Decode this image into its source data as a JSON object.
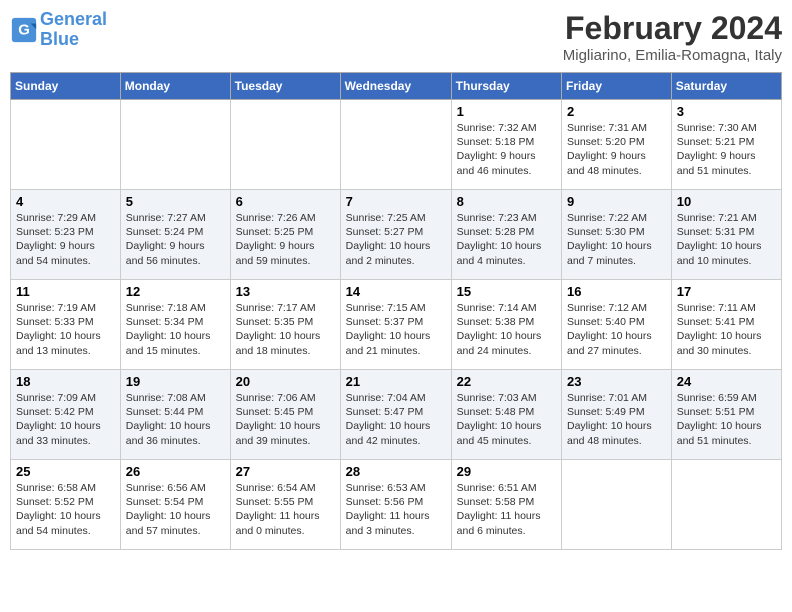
{
  "header": {
    "logo_line1": "General",
    "logo_line2": "Blue",
    "month_title": "February 2024",
    "location": "Migliarino, Emilia-Romagna, Italy"
  },
  "days_of_week": [
    "Sunday",
    "Monday",
    "Tuesday",
    "Wednesday",
    "Thursday",
    "Friday",
    "Saturday"
  ],
  "weeks": [
    [
      {
        "day": "",
        "info": ""
      },
      {
        "day": "",
        "info": ""
      },
      {
        "day": "",
        "info": ""
      },
      {
        "day": "",
        "info": ""
      },
      {
        "day": "1",
        "info": "Sunrise: 7:32 AM\nSunset: 5:18 PM\nDaylight: 9 hours\nand 46 minutes."
      },
      {
        "day": "2",
        "info": "Sunrise: 7:31 AM\nSunset: 5:20 PM\nDaylight: 9 hours\nand 48 minutes."
      },
      {
        "day": "3",
        "info": "Sunrise: 7:30 AM\nSunset: 5:21 PM\nDaylight: 9 hours\nand 51 minutes."
      }
    ],
    [
      {
        "day": "4",
        "info": "Sunrise: 7:29 AM\nSunset: 5:23 PM\nDaylight: 9 hours\nand 54 minutes."
      },
      {
        "day": "5",
        "info": "Sunrise: 7:27 AM\nSunset: 5:24 PM\nDaylight: 9 hours\nand 56 minutes."
      },
      {
        "day": "6",
        "info": "Sunrise: 7:26 AM\nSunset: 5:25 PM\nDaylight: 9 hours\nand 59 minutes."
      },
      {
        "day": "7",
        "info": "Sunrise: 7:25 AM\nSunset: 5:27 PM\nDaylight: 10 hours\nand 2 minutes."
      },
      {
        "day": "8",
        "info": "Sunrise: 7:23 AM\nSunset: 5:28 PM\nDaylight: 10 hours\nand 4 minutes."
      },
      {
        "day": "9",
        "info": "Sunrise: 7:22 AM\nSunset: 5:30 PM\nDaylight: 10 hours\nand 7 minutes."
      },
      {
        "day": "10",
        "info": "Sunrise: 7:21 AM\nSunset: 5:31 PM\nDaylight: 10 hours\nand 10 minutes."
      }
    ],
    [
      {
        "day": "11",
        "info": "Sunrise: 7:19 AM\nSunset: 5:33 PM\nDaylight: 10 hours\nand 13 minutes."
      },
      {
        "day": "12",
        "info": "Sunrise: 7:18 AM\nSunset: 5:34 PM\nDaylight: 10 hours\nand 15 minutes."
      },
      {
        "day": "13",
        "info": "Sunrise: 7:17 AM\nSunset: 5:35 PM\nDaylight: 10 hours\nand 18 minutes."
      },
      {
        "day": "14",
        "info": "Sunrise: 7:15 AM\nSunset: 5:37 PM\nDaylight: 10 hours\nand 21 minutes."
      },
      {
        "day": "15",
        "info": "Sunrise: 7:14 AM\nSunset: 5:38 PM\nDaylight: 10 hours\nand 24 minutes."
      },
      {
        "day": "16",
        "info": "Sunrise: 7:12 AM\nSunset: 5:40 PM\nDaylight: 10 hours\nand 27 minutes."
      },
      {
        "day": "17",
        "info": "Sunrise: 7:11 AM\nSunset: 5:41 PM\nDaylight: 10 hours\nand 30 minutes."
      }
    ],
    [
      {
        "day": "18",
        "info": "Sunrise: 7:09 AM\nSunset: 5:42 PM\nDaylight: 10 hours\nand 33 minutes."
      },
      {
        "day": "19",
        "info": "Sunrise: 7:08 AM\nSunset: 5:44 PM\nDaylight: 10 hours\nand 36 minutes."
      },
      {
        "day": "20",
        "info": "Sunrise: 7:06 AM\nSunset: 5:45 PM\nDaylight: 10 hours\nand 39 minutes."
      },
      {
        "day": "21",
        "info": "Sunrise: 7:04 AM\nSunset: 5:47 PM\nDaylight: 10 hours\nand 42 minutes."
      },
      {
        "day": "22",
        "info": "Sunrise: 7:03 AM\nSunset: 5:48 PM\nDaylight: 10 hours\nand 45 minutes."
      },
      {
        "day": "23",
        "info": "Sunrise: 7:01 AM\nSunset: 5:49 PM\nDaylight: 10 hours\nand 48 minutes."
      },
      {
        "day": "24",
        "info": "Sunrise: 6:59 AM\nSunset: 5:51 PM\nDaylight: 10 hours\nand 51 minutes."
      }
    ],
    [
      {
        "day": "25",
        "info": "Sunrise: 6:58 AM\nSunset: 5:52 PM\nDaylight: 10 hours\nand 54 minutes."
      },
      {
        "day": "26",
        "info": "Sunrise: 6:56 AM\nSunset: 5:54 PM\nDaylight: 10 hours\nand 57 minutes."
      },
      {
        "day": "27",
        "info": "Sunrise: 6:54 AM\nSunset: 5:55 PM\nDaylight: 11 hours\nand 0 minutes."
      },
      {
        "day": "28",
        "info": "Sunrise: 6:53 AM\nSunset: 5:56 PM\nDaylight: 11 hours\nand 3 minutes."
      },
      {
        "day": "29",
        "info": "Sunrise: 6:51 AM\nSunset: 5:58 PM\nDaylight: 11 hours\nand 6 minutes."
      },
      {
        "day": "",
        "info": ""
      },
      {
        "day": "",
        "info": ""
      }
    ]
  ]
}
